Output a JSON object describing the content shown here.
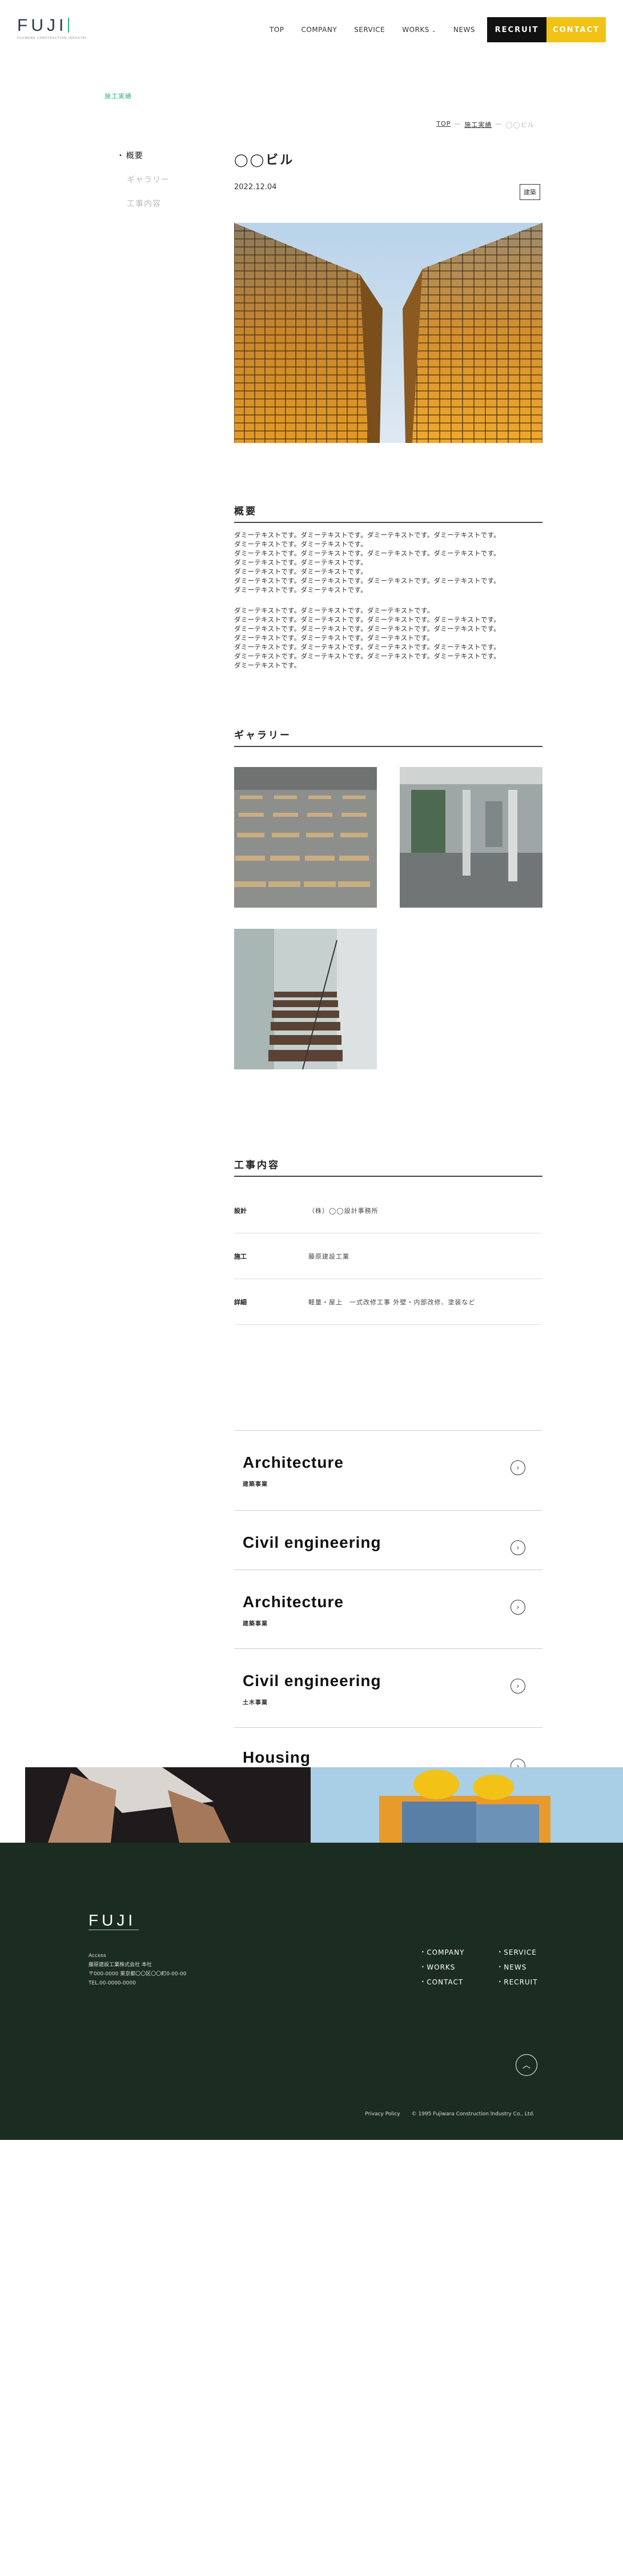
{
  "header": {
    "logo": "FUJI",
    "logo_sub": "FUJIWARA CONSTRUCTION INDUSTRY",
    "nav": [
      "TOP",
      "COMPANY",
      "SERVICE",
      "WORKS",
      "NEWS"
    ],
    "recruit": "RECRUIT",
    "contact": "CONTACT"
  },
  "page_heading": "施工実績",
  "breadcrumb": {
    "top": "TOP",
    "sep": "—",
    "parent": "施工実績",
    "current": "◯◯ビル"
  },
  "sidebar": [
    "概要",
    "ギャラリー",
    "工事内容"
  ],
  "post": {
    "title": "◯◯ビル",
    "date": "2022.12.04",
    "tag": "建築"
  },
  "overview": {
    "title": "概要",
    "para1": [
      "ダミーテキストです。ダミーテキストです。ダミーテキストです。ダミーテキストです。",
      "ダミーテキストです。ダミーテキストです。",
      "ダミーテキストです。ダミーテキストです。ダミーテキストです。ダミーテキストです。",
      "ダミーテキストです。ダミーテキストです。",
      "ダミーテキストです。ダミーテキストです。",
      "ダミーテキストです。ダミーテキストです。ダミーテキストです。ダミーテキストです。",
      "ダミーテキストです。ダミーテキストです。"
    ],
    "para2": [
      "ダミーテキストです。ダミーテキストです。ダミーテキストです。",
      "ダミーテキストです。ダミーテキストです。ダミーテキストです。ダミーテキストです。",
      "ダミーテキストです。ダミーテキストです。ダミーテキストです。ダミーテキストです。",
      "ダミーテキストです。ダミーテキストです。ダミーテキストです。",
      "ダミーテキストです。ダミーテキストです。ダミーテキストです。ダミーテキストです。",
      "ダミーテキストです。ダミーテキストです。ダミーテキストです。ダミーテキストです。",
      "ダミーテキストです。"
    ]
  },
  "gallery": {
    "title": "ギャラリー"
  },
  "details": {
    "title": "工事内容",
    "rows": [
      {
        "label": "設計",
        "value": "（株）◯◯設計事務所"
      },
      {
        "label": "施工",
        "value": "藤原建設工業"
      },
      {
        "label": "詳細",
        "value": "軽量・屋上　一式改修工事 外壁・内部改修、塗装など"
      }
    ]
  },
  "services": [
    {
      "title": "Architecture",
      "sub": "建築事業"
    },
    {
      "title": "Civil engineering",
      "sub": ""
    },
    {
      "title": "Architecture",
      "sub": "建築事業"
    },
    {
      "title": "Civil engineering",
      "sub": "土木事業"
    },
    {
      "title": "Housing",
      "sub": ""
    }
  ],
  "footer": {
    "logo": "FUJI",
    "address": [
      "Access",
      "藤原建設工業株式会社 本社",
      "〒000-0000 東京都〇〇区〇〇町0-00-00",
      "TEL.00-0000-0000"
    ],
    "links": [
      "COMPANY",
      "SERVICE",
      "WORKS",
      "NEWS",
      "CONTACT",
      "RECRUIT"
    ],
    "privacy": "Privacy Policy",
    "copyright": "© 1995 Fujiwara Construction Industry Co., Ltd."
  }
}
